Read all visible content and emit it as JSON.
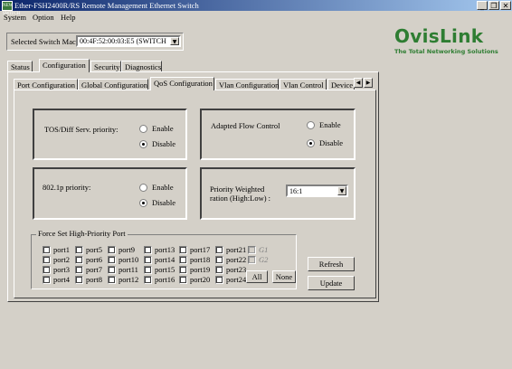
{
  "window": {
    "app_icon": "NEW SWITCH",
    "title": "Ether-FSH2400R/RS Remote Management Ethernet Switch",
    "controls": [
      "minimize-icon",
      "restore-icon",
      "close-icon"
    ]
  },
  "menu": {
    "items": [
      {
        "label": "System"
      },
      {
        "label": "Option"
      },
      {
        "label": "Help"
      }
    ]
  },
  "selector": {
    "label": "Selected Switch Mac:",
    "value": "00:4F:52:00:03:E5 (SWITCH"
  },
  "logo": {
    "name": "OvisLink",
    "tagline": "The Total Networking Solutions"
  },
  "main_tabs": [
    "Status",
    "Configuration",
    "Security",
    "Diagnostics"
  ],
  "main_tabs_active": "Configuration",
  "sub_tabs": [
    "Port Configuration",
    "Global Configuration",
    "QoS Configuration",
    "Vlan Configuration",
    "Vlan Control",
    "Device"
  ],
  "sub_tabs_active": "QoS Configuration",
  "qos": {
    "tos": {
      "label": "TOS/Diff Serv. priority:",
      "enable": "Enable",
      "disable": "Disable",
      "selected": "Disable"
    },
    "flow": {
      "label": "Adapted Flow Control",
      "enable": "Enable",
      "disable": "Disable",
      "selected": "Disable"
    },
    "dot1p": {
      "label": "802.1p priority:",
      "enable": "Enable",
      "disable": "Disable",
      "selected": "Disable"
    },
    "weighted": {
      "label_line1": "Priority Weighted",
      "label_line2": "ration (High:Low) :",
      "value": "16:1"
    }
  },
  "force": {
    "title": "Force Set High-Priority Port",
    "ports": [
      "port1",
      "port2",
      "port3",
      "port4",
      "port5",
      "port6",
      "port7",
      "port8",
      "port9",
      "port10",
      "port11",
      "port12",
      "port13",
      "port14",
      "port15",
      "port16",
      "port17",
      "port18",
      "port19",
      "port20",
      "port21",
      "port22",
      "port23",
      "port24"
    ],
    "extra": [
      "G1",
      "G2"
    ],
    "all_label": "All",
    "none_label": "None"
  },
  "buttons": {
    "refresh": "Refresh",
    "update": "Update"
  }
}
